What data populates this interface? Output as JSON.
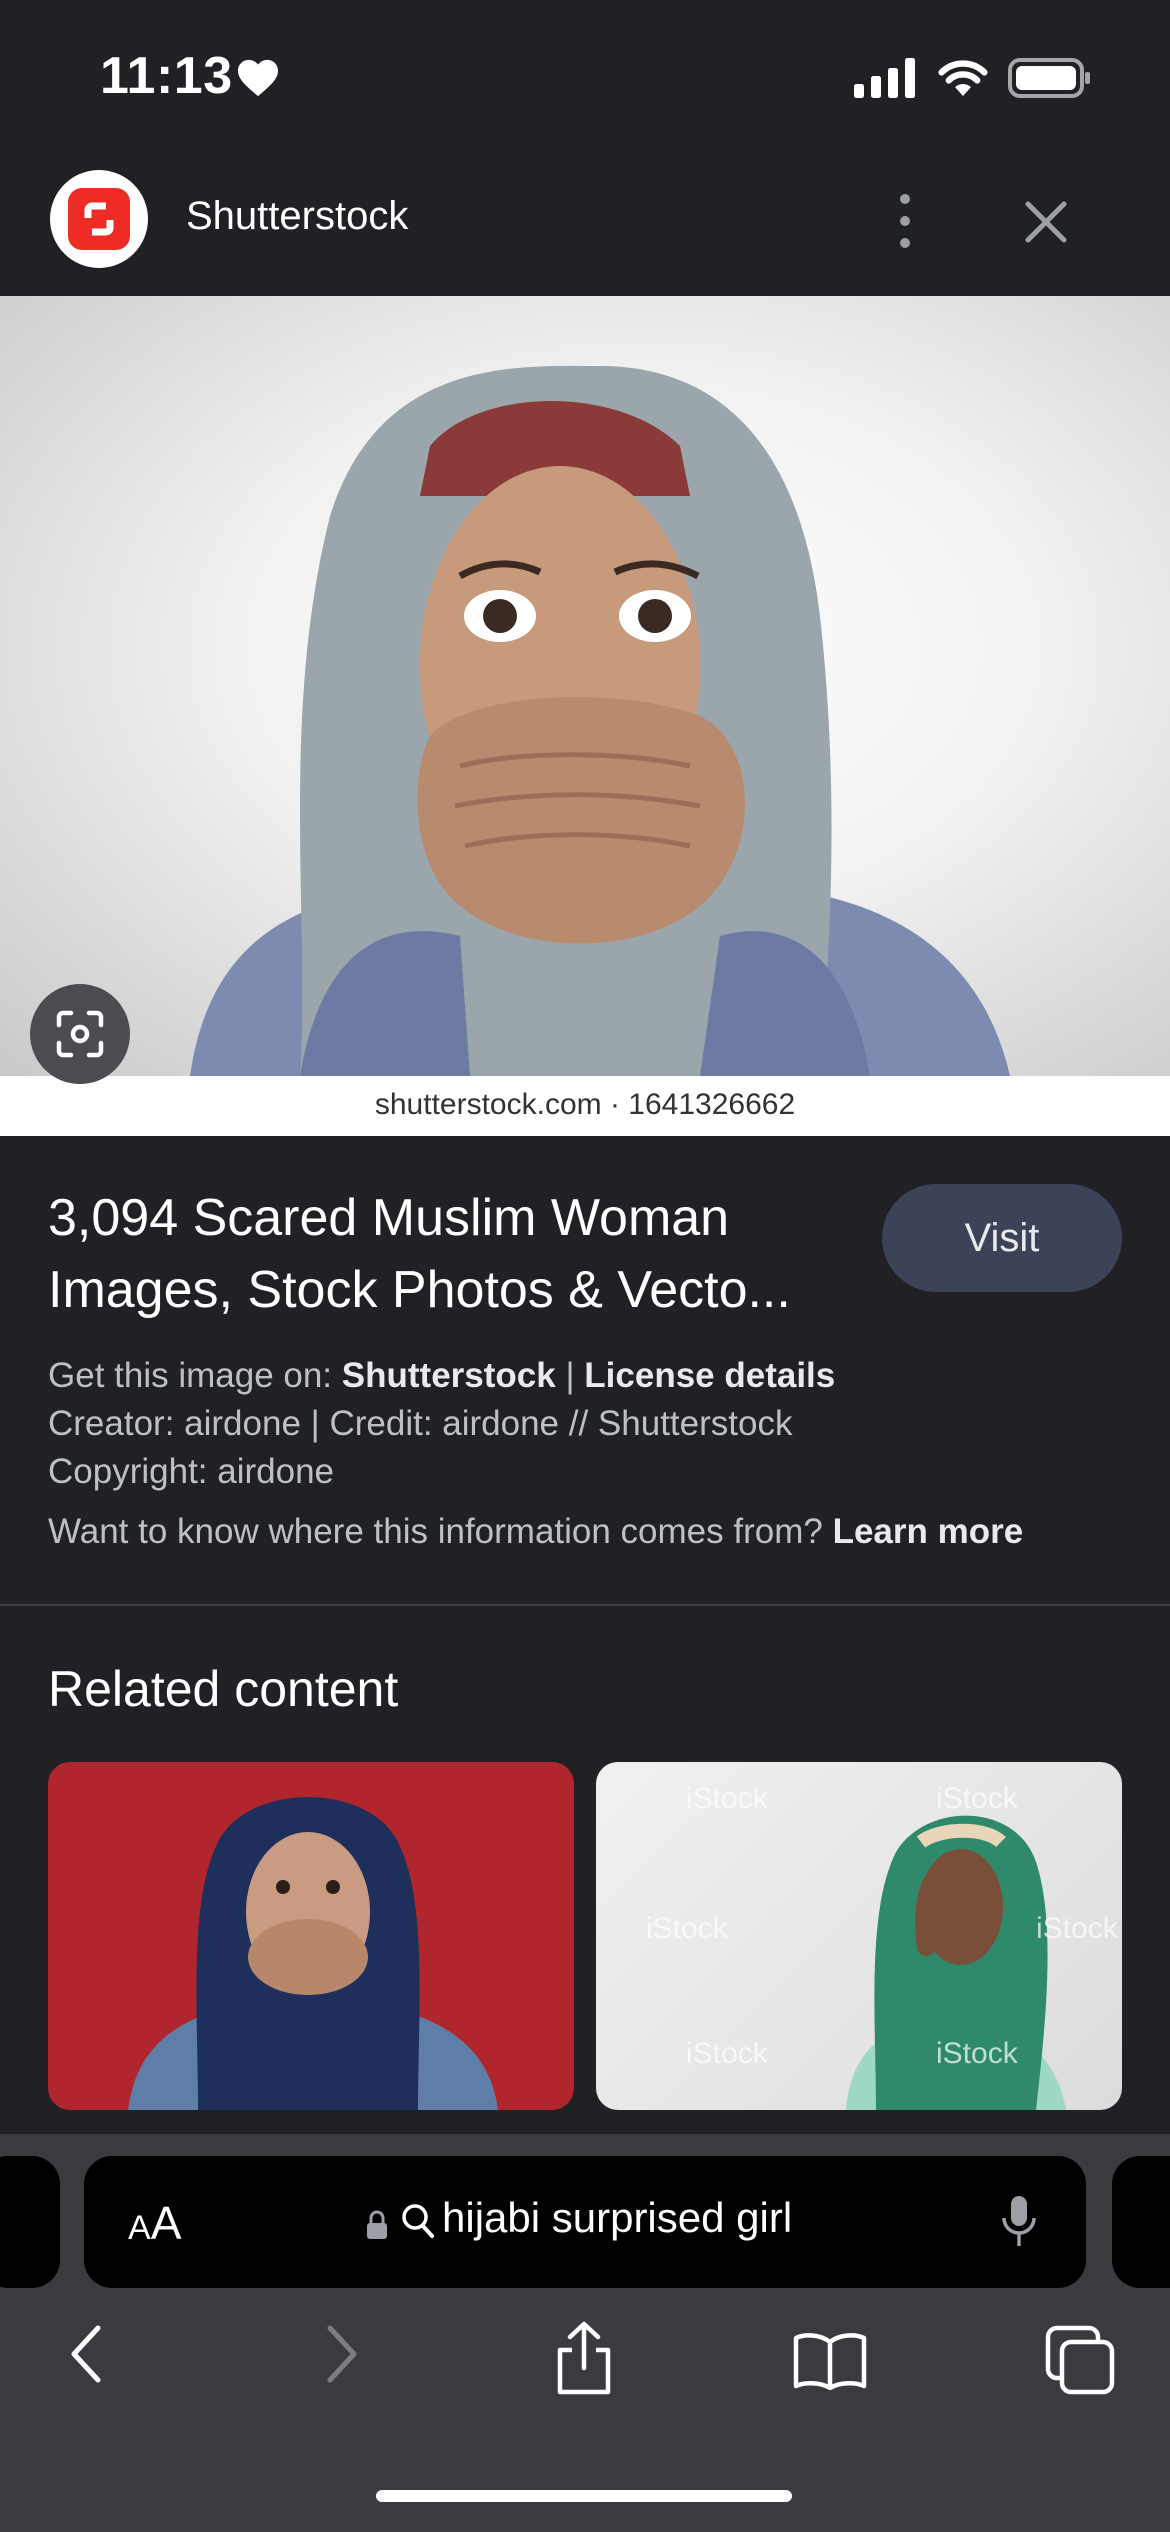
{
  "status_bar": {
    "time": "11:13"
  },
  "header": {
    "site_name": "Shutterstock"
  },
  "image": {
    "watermark_caption": "shutterstock.com · 1641326662"
  },
  "result": {
    "title": "3,094 Scared Muslim Woman Images, Stock Photos & Vecto...",
    "visit_label": "Visit",
    "get_image_prefix": "Get this image on:",
    "get_image_source": "Shutterstock",
    "separator": "|",
    "license_details": "License details",
    "creator_line": "Creator: airdone | Credit: airdone // Shutterstock",
    "copyright_line": "Copyright: airdone",
    "info_question": "Want to know where this information comes from?",
    "learn_more": "Learn more"
  },
  "related": {
    "title": "Related content",
    "thumb2_watermarks": [
      "iStock",
      "iStock",
      "iStock",
      "iStock",
      "iStock",
      "iStock"
    ]
  },
  "address_bar": {
    "text_size_small": "A",
    "text_size_large": "A",
    "query": "hijabi surprised girl"
  },
  "icons": [
    "heart-icon",
    "signal-icon",
    "wifi-icon",
    "battery-icon",
    "shutterstock-logo-icon",
    "more-vert-icon",
    "close-icon",
    "lens-icon",
    "lock-icon",
    "search-icon",
    "mic-icon",
    "back-icon",
    "forward-icon",
    "share-icon",
    "bookmarks-icon",
    "tabs-icon"
  ],
  "colors": {
    "background": "#202124",
    "visit_button": "#3c4358",
    "brand_red": "#ee2b24",
    "toolbar": "#3a3b3e"
  }
}
